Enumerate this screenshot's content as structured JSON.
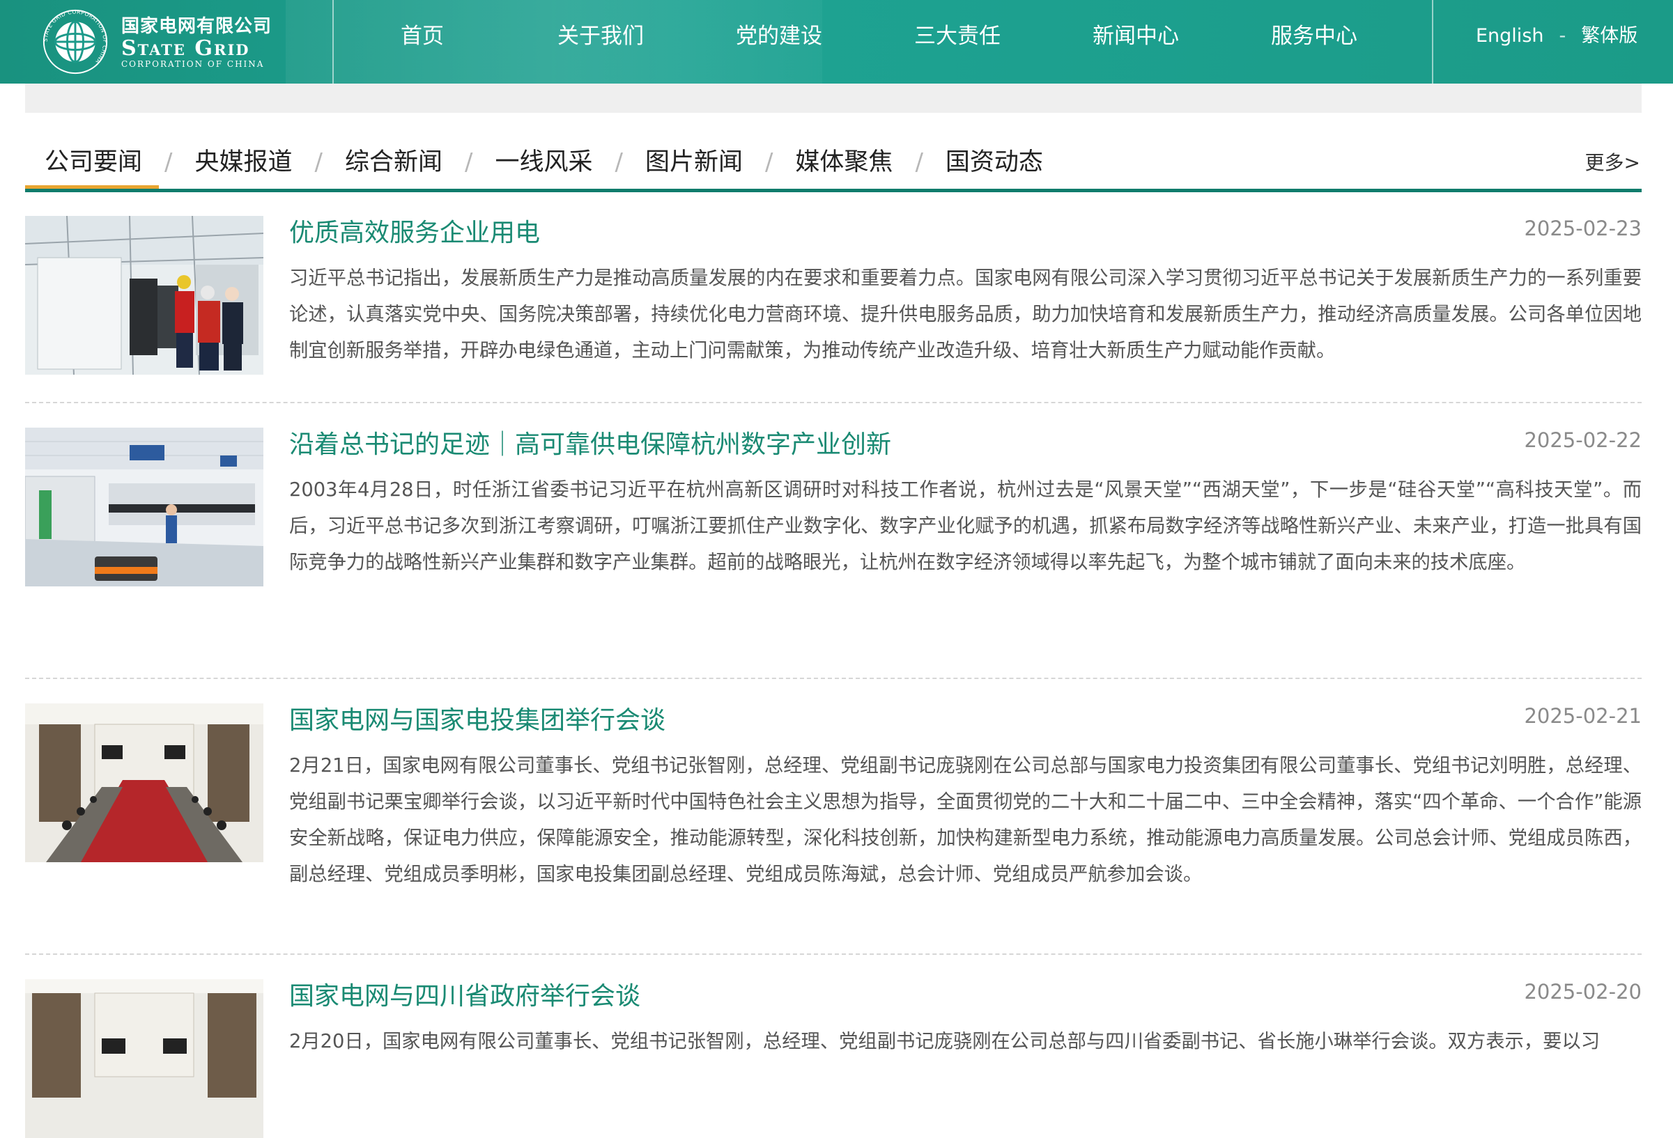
{
  "header": {
    "logo_cn": "国家电网有限公司",
    "logo_en": "State Grid",
    "logo_sub": "CORPORATION OF CHINA",
    "logo_ring_text": "STATE GRID CORPORATION OF CHINA",
    "nav": [
      {
        "label": "首页"
      },
      {
        "label": "关于我们"
      },
      {
        "label": "党的建设"
      },
      {
        "label": "三大责任"
      },
      {
        "label": "新闻中心"
      },
      {
        "label": "服务中心"
      }
    ],
    "lang": {
      "english": "English",
      "separator": "-",
      "traditional": "繁体版"
    }
  },
  "tabs": {
    "items": [
      "公司要闻",
      "央媒报道",
      "综合新闻",
      "一线风采",
      "图片新闻",
      "媒体聚焦",
      "国资动态"
    ],
    "active_index": 0,
    "separator": "/",
    "more_label": "更多>"
  },
  "news": [
    {
      "title": "优质高效服务企业用电",
      "date": "2025-02-23",
      "summary": "习近平总书记指出，发展新质生产力是推动高质量发展的内在要求和重要着力点。国家电网有限公司深入学习贯彻习近平总书记关于发展新质生产力的一系列重要论述，认真落实党中央、国务院决策部署，持续优化电力营商环境、提升供电服务品质，助力加快培育和发展新质生产力，推动经济高质量发展。公司各单位因地制宜创新服务举措，开辟办电绿色通道，主动上门问需献策，为推动传统产业改造升级、培育壮大新质生产力赋动能作贡献。"
    },
    {
      "title": "沿着总书记的足迹｜高可靠供电保障杭州数字产业创新",
      "date": "2025-02-22",
      "summary": "2003年4月28日，时任浙江省委书记习近平在杭州高新区调研时对科技工作者说，杭州过去是“风景天堂”“西湖天堂”，下一步是“硅谷天堂”“高科技天堂”。而后，习近平总书记多次到浙江考察调研，叮嘱浙江要抓住产业数字化、数字产业化赋予的机遇，抓紧布局数字经济等战略性新兴产业、未来产业，打造一批具有国际竞争力的战略性新兴产业集群和数字产业集群。超前的战略眼光，让杭州在数字经济领域得以率先起飞，为整个城市铺就了面向未来的技术底座。"
    },
    {
      "title": "国家电网与国家电投集团举行会谈",
      "date": "2025-02-21",
      "summary": "2月21日，国家电网有限公司董事长、党组书记张智刚，总经理、党组副书记庞骁刚在公司总部与国家电力投资集团有限公司董事长、党组书记刘明胜，总经理、党组副书记栗宝卿举行会谈，以习近平新时代中国特色社会主义思想为指导，全面贯彻党的二十大和二十届二中、三中全会精神，落实“四个革命、一个合作”能源安全新战略，保证电力供应，保障能源安全，推动能源转型，深化科技创新，加快构建新型电力系统，推动能源电力高质量发展。公司总会计师、党组成员陈西，副总经理、党组成员季明彬，国家电投集团副总经理、党组成员陈海斌，总会计师、党组成员严航参加会谈。"
    },
    {
      "title": "国家电网与四川省政府举行会谈",
      "date": "2025-02-20",
      "summary": "2月20日，国家电网有限公司董事长、党组书记张智刚，总经理、党组副书记庞骁刚在公司总部与四川省委副书记、省长施小琳举行会谈。双方表示，要以习"
    }
  ],
  "colors": {
    "header_bg": "#1c9a8a",
    "title_green": "#1a8a73",
    "tab_underline": "#0f7c6c",
    "tab_active": "#e8a531"
  }
}
